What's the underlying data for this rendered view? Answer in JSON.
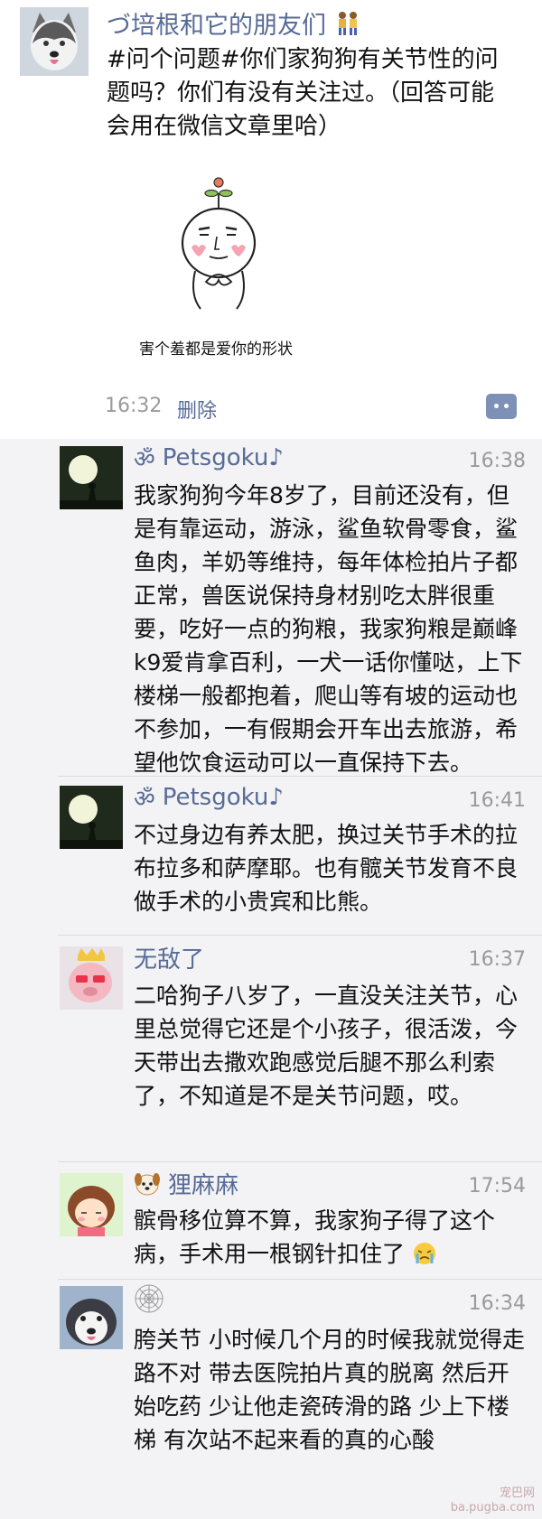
{
  "post": {
    "author": "づ培根和它的朋友们",
    "text": "#问个问题#你们家狗狗有关节性的问题吗？你们有没有关注过。（回答可能会用在微信文章里哈）",
    "image_caption": "害个羞都是爱你的形状",
    "time": "16:32",
    "delete_label": "删除"
  },
  "comments": [
    {
      "name": "Petsgoku♪",
      "time": "16:38",
      "text": "我家狗狗今年8岁了，目前还没有，但是有靠运动，游泳，鲨鱼软骨零食，鲨鱼肉，羊奶等维持，每年体检拍片子都正常，兽医说保持身材别吃太胖很重要，吃好一点的狗粮，我家狗粮是巅峰k9爱肯拿百利，一犬一话你懂哒，上下楼梯一般都抱着，爬山等有坡的运动也不参加，一有假期会开车出去旅游，希望他饮食运动可以一直保持下去。"
    },
    {
      "name": "Petsgoku♪",
      "time": "16:41",
      "text": "不过身边有养太肥，换过关节手术的拉布拉多和萨摩耶。也有髋关节发育不良做手术的小贵宾和比熊。"
    },
    {
      "name": "无敌了",
      "time": "16:37",
      "text": "二哈狗子八岁了，一直没关注关节，心里总觉得它还是个小孩子，很活泼，今天带出去撒欢跑感觉后腿不那么利索了，不知道是不是关节问题，哎。"
    },
    {
      "name": "狸麻麻",
      "time": "17:54",
      "text": "髌骨移位算不算，我家狗子得了这个病，手术用一根钢针扣住了"
    },
    {
      "name": "",
      "time": "16:34",
      "text": "胯关节 小时候几个月的时候我就觉得走路不对 带去医院拍片真的脱离 然后开始吃药 少让他走瓷砖滑的路 少上下楼梯 有次站不起来看的真的心酸"
    }
  ],
  "watermark": {
    "line1": "宠巴网",
    "line2": "ba.pugba.com"
  }
}
